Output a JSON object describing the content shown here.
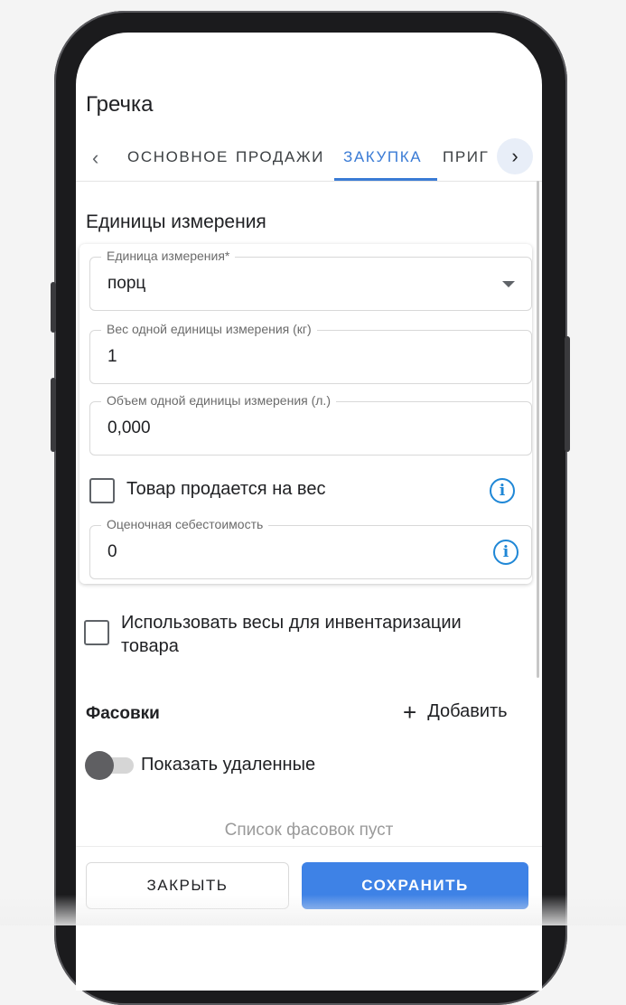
{
  "header": {
    "title": "Гречка"
  },
  "tabs": {
    "prev_icon": "chevron-left-icon",
    "next_icon": "chevron-right-icon",
    "items": [
      {
        "label": "ОСНОВНОЕ",
        "active": false
      },
      {
        "label": "ПРОДАЖИ",
        "active": false
      },
      {
        "label": "ЗАКУПКА",
        "active": true
      },
      {
        "label": "ПРИГ",
        "active": false
      }
    ]
  },
  "units": {
    "title": "Единицы измерения",
    "unit": {
      "label": "Единица измерения*",
      "value": "порц"
    },
    "weight": {
      "label": "Вес одной единицы измерения (кг)",
      "value": "1"
    },
    "volume": {
      "label": "Объем одной единицы измерения (л.)",
      "value": "0,000"
    },
    "sold_by_weight": {
      "label": "Товар продается на вес",
      "checked": false
    },
    "cost": {
      "label": "Оценочная себестоимость",
      "value": "0"
    }
  },
  "inventory_scales": {
    "label_line1": "Использовать весы для инвентаризации",
    "label_line2": "товара",
    "checked": false
  },
  "packages": {
    "title": "Фасовки",
    "add_label": "Добавить",
    "show_deleted_label": "Показать удаленные",
    "show_deleted": false,
    "empty_text": "Список фасовок пуст"
  },
  "footer": {
    "close_label": "ЗАКРЫТЬ",
    "save_label": "СОХРАНИТЬ"
  },
  "colors": {
    "accent": "#3a7bd5",
    "save_button": "#3e82e6",
    "info_icon": "#1f87d6"
  }
}
